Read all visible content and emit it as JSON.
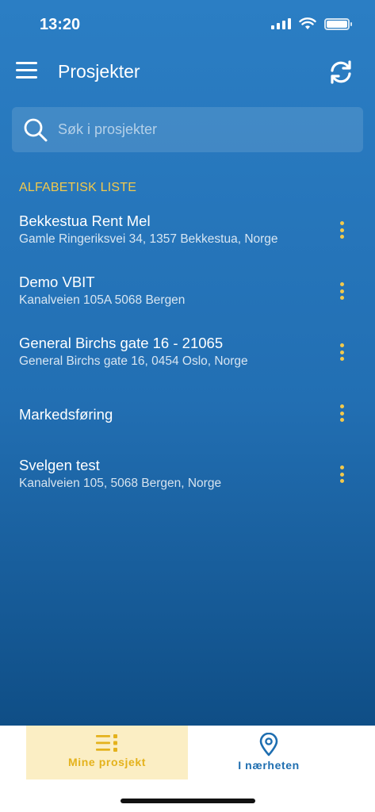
{
  "status_bar": {
    "time": "13:20"
  },
  "header": {
    "title": "Prosjekter"
  },
  "search": {
    "placeholder": "Søk i prosjekter",
    "value": ""
  },
  "section_label": "ALFABETISK LISTE",
  "projects": [
    {
      "name": "Bekkestua Rent Mel",
      "address": "Gamle Ringeriksvei 34, 1357 Bekkestua, Norge"
    },
    {
      "name": "Demo VBIT",
      "address": "Kanalveien 105A 5068 Bergen"
    },
    {
      "name": "General Birchs gate 16 - 21065",
      "address": "General Birchs gate 16, 0454 Oslo, Norge"
    },
    {
      "name": "Markedsføring",
      "address": ""
    },
    {
      "name": "Svelgen test",
      "address": "Kanalveien 105, 5068 Bergen, Norge"
    }
  ],
  "tabs": [
    {
      "label": "Mine prosjekt",
      "icon": "list-icon",
      "active": true
    },
    {
      "label": "I nærheten",
      "icon": "location-pin-icon",
      "active": false
    }
  ],
  "colors": {
    "accent": "#f2c94c",
    "background_top": "#2b7ec4",
    "background_bottom": "#0f4e86",
    "active_tab_bg": "#fbeec4",
    "inactive_tab_text": "#1e6eb0"
  }
}
